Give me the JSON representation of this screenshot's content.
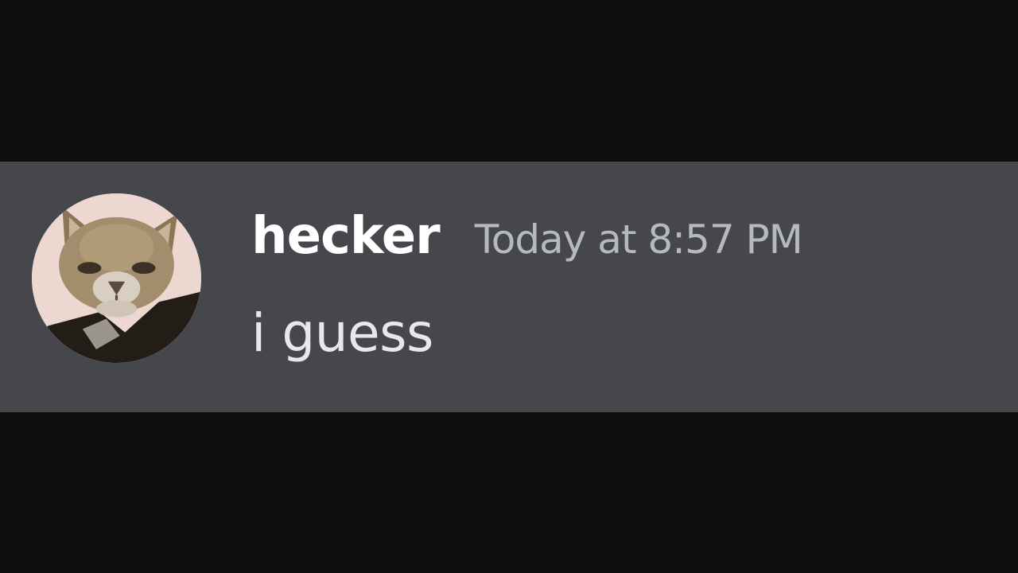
{
  "message": {
    "username": "hecker",
    "timestamp": "Today at 8:57 PM",
    "text": "i guess",
    "avatar": "cat-avatar"
  },
  "colors": {
    "background": "#0f0f10",
    "message_row": "#45474c",
    "username": "#ffffff",
    "timestamp": "#b6b9be",
    "text": "#e7e8ea"
  }
}
